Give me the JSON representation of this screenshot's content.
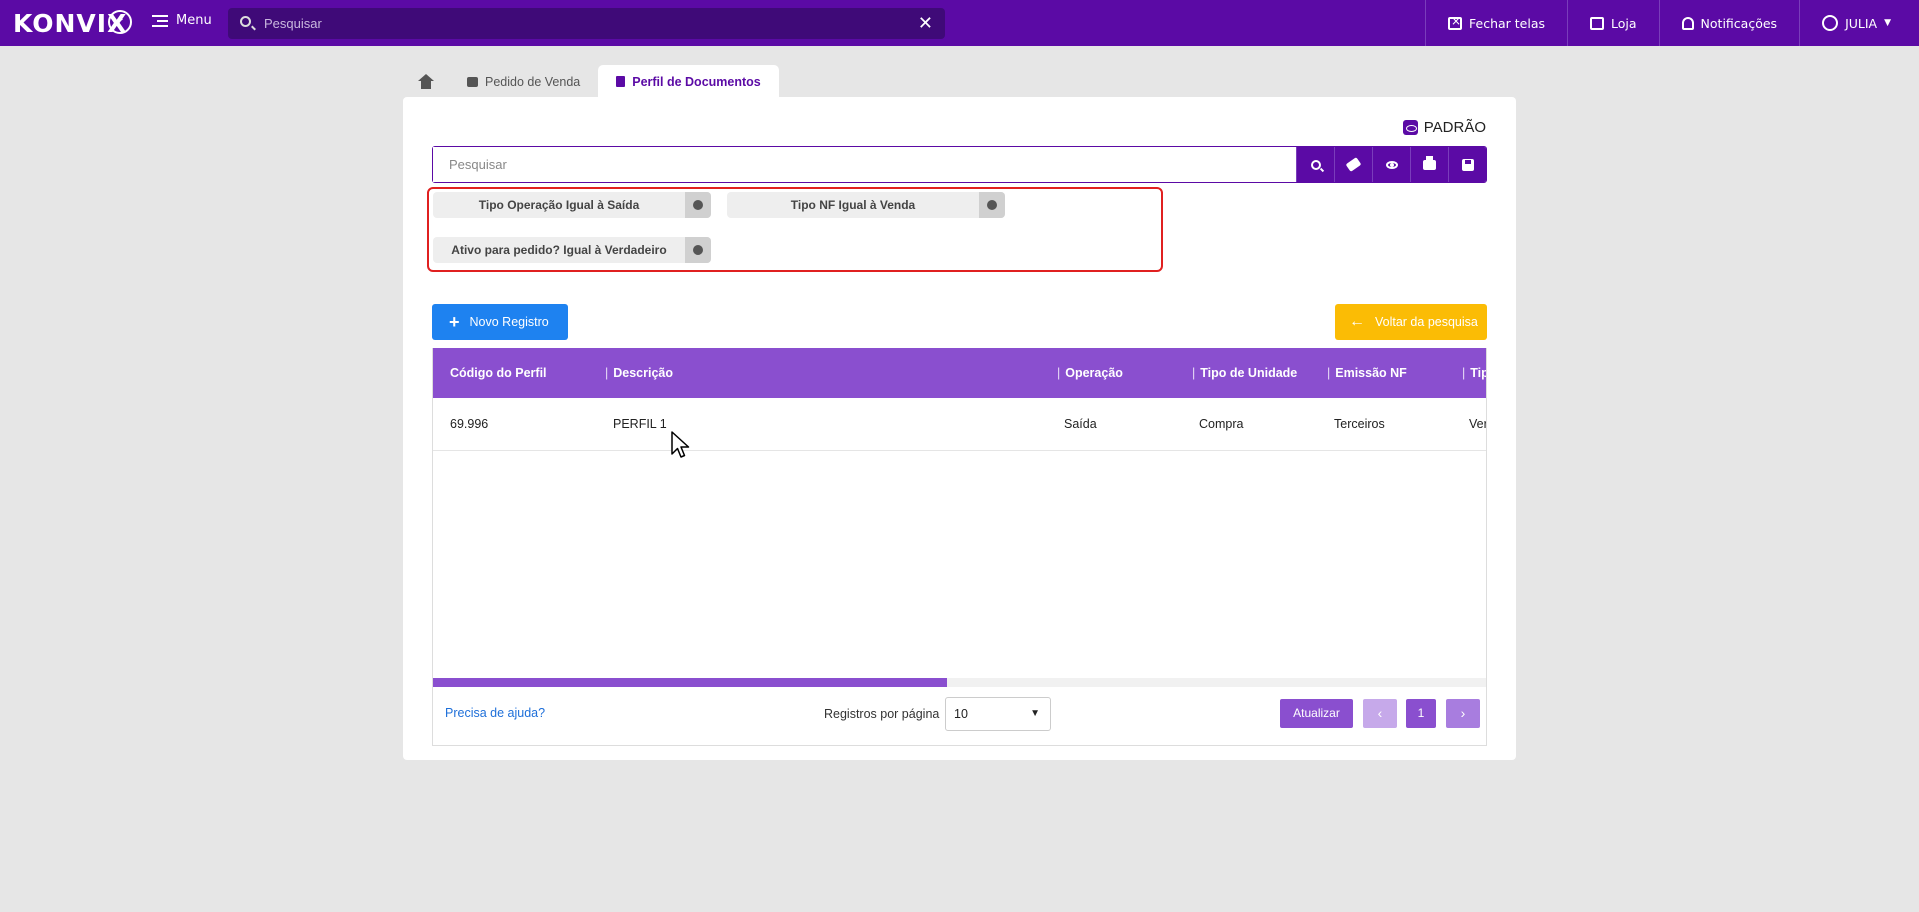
{
  "topbar": {
    "logo": "KONVIX",
    "menu_label": "Menu",
    "search_placeholder": "Pesquisar",
    "fechar_telas": "Fechar telas",
    "loja": "Loja",
    "notificacoes": "Notificações",
    "user": "JULIA"
  },
  "tabs": [
    {
      "label": "Pedido de Venda"
    },
    {
      "label": "Perfil de Documentos"
    }
  ],
  "panel": {
    "view_label": "PADRÃO",
    "search_placeholder": "Pesquisar",
    "filters": [
      "Tipo Operação Igual à Saída",
      "Tipo NF Igual à Venda",
      "Ativo para pedido? Igual à Verdadeiro"
    ],
    "novo_registro": "Novo Registro",
    "voltar": "Voltar da pesquisa"
  },
  "table": {
    "columns": [
      "Código do Perfil",
      "Descrição",
      "Operação",
      "Tipo de Unidade",
      "Emissão NF",
      "Tip"
    ],
    "rows": [
      [
        "69.996",
        "PERFIL 1",
        "Saída",
        "Compra",
        "Terceiros",
        "Ver"
      ]
    ]
  },
  "footer": {
    "help": "Precisa de ajuda?",
    "rpp_label": "Registros por página",
    "rpp_value": "10",
    "atualizar": "Atualizar",
    "page": "1"
  },
  "colors": {
    "brand": "#5b0aa5",
    "table_header": "#8a4fcf",
    "primary_button": "#1e82f0",
    "warning_button": "#fbbc05",
    "filter_highlight": "#e02020"
  }
}
